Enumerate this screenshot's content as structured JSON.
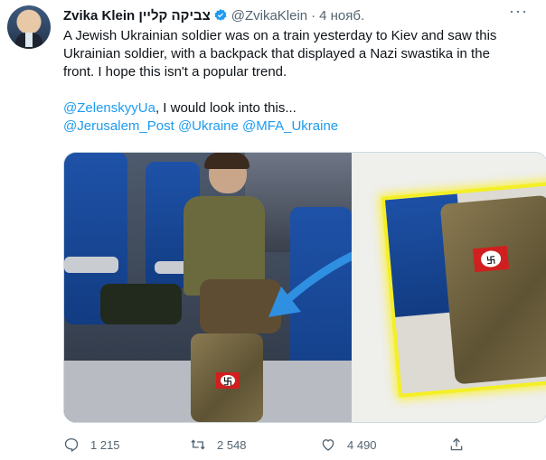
{
  "tweet": {
    "author_name": "Zvika Klein צביקה קליין",
    "handle": "@ZvikaKlein",
    "separator": "·",
    "date": "4 нояб.",
    "text_line1": "A Jewish Ukrainian soldier was on a train yesterday to Kiev and saw this",
    "text_line2": "Ukrainian soldier, with a backpack that displayed a Nazi swastika in the",
    "text_line3": "front. I hope this isn't a popular trend.",
    "mention1": "@ZelenskyyUa",
    "mention_suffix": ", I would look into this...",
    "mention2": "@Jerusalem_Post",
    "mention3": "@Ukraine",
    "mention4": "@MFA_Ukraine"
  },
  "stats": {
    "replies": "1 215",
    "retweets": "2 548",
    "likes": "4 490"
  },
  "icons": {
    "verified": "verified-badge-icon",
    "more": "more-options-icon",
    "reply": "reply-icon",
    "retweet": "retweet-icon",
    "like": "heart-icon",
    "share": "share-icon"
  },
  "colors": {
    "link": "#1d9bf0",
    "secondary_text": "#536471",
    "highlight": "#f4ef26"
  }
}
